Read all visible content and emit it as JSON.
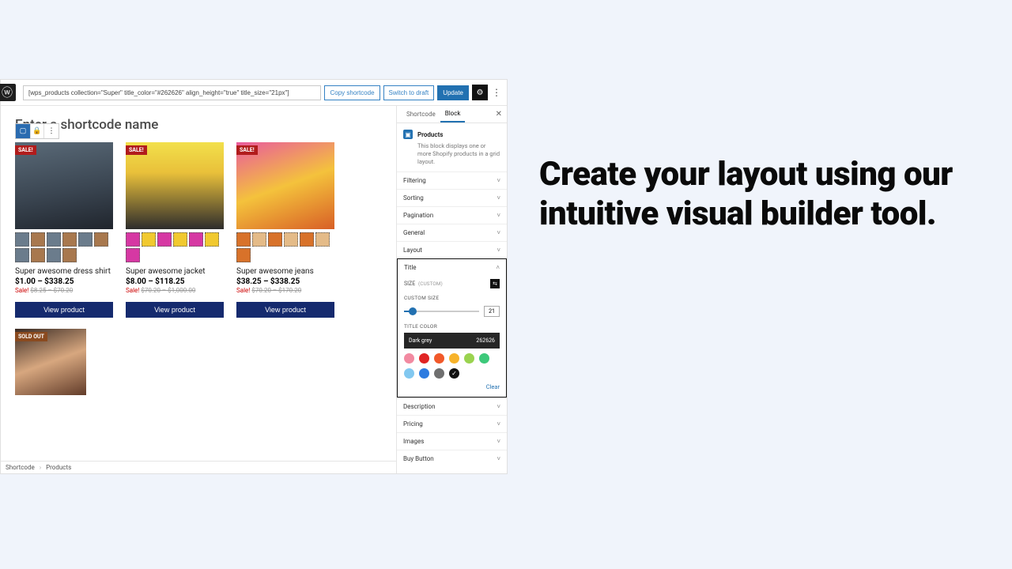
{
  "headline": "Create your layout using our intuitive visual builder tool.",
  "topbar": {
    "shortcode": "[wps_products collection=\"Super\" title_color=\"#262626\" align_height=\"true\" title_size=\"21px\"]",
    "copy": "Copy shortcode",
    "draft": "Switch to draft",
    "update": "Update"
  },
  "canvas": {
    "heading": "Enter a shortcode name"
  },
  "products": [
    {
      "badge": "SALE!",
      "badgeClass": "sale",
      "heroClass": "h1",
      "thumbCount": 10,
      "name": "Super awesome dress shirt",
      "price": "$1.00 – $338.25",
      "sale_prefix": "Sale!",
      "sale_old": "$8.25 – $70.20",
      "button": "View product"
    },
    {
      "badge": "SALE!",
      "badgeClass": "sale",
      "heroClass": "h2",
      "thumbCount": 7,
      "name": "Super awesome jacket",
      "price": "$8.00 – $118.25",
      "sale_prefix": "Sale!",
      "sale_old": "$70.20 – $1,000.00",
      "button": "View product"
    },
    {
      "badge": "SALE!",
      "badgeClass": "sale",
      "heroClass": "h3",
      "thumbCount": 7,
      "name": "Super awesome jeans",
      "price": "$38.25 – $338.25",
      "sale_prefix": "Sale!",
      "sale_old": "$70.20 – $170.20",
      "button": "View product"
    }
  ],
  "product_extra": {
    "badge": "SOLD OUT",
    "badgeClass": "soldout",
    "heroClass": "h4"
  },
  "breadcrumb": {
    "a": "Shortcode",
    "b": "Products"
  },
  "sidebar": {
    "tabs": {
      "a": "Shortcode",
      "b": "Block"
    },
    "block": {
      "title": "Products",
      "sub": "This block displays one or more Shopify products in a grid layout."
    },
    "panels_before": [
      "Filtering",
      "Sorting",
      "Pagination",
      "General",
      "Layout"
    ],
    "title_panel": {
      "label": "Title",
      "size_label": "SIZE",
      "size_custom": "(CUSTOM)",
      "custom_size_label": "CUSTOM SIZE",
      "custom_size_value": "21",
      "title_color_label": "TITLE COLOR",
      "swatch_name": "Dark grey",
      "swatch_hex": "262626",
      "colors": [
        "#f28aa1",
        "#e02424",
        "#f1592a",
        "#f7b32b",
        "#9ad34f",
        "#3dc97a",
        "#82c8f0",
        "#2d7be0",
        "#6f6f6f",
        "#111111"
      ],
      "checked_index": 9,
      "clear": "Clear"
    },
    "panels_after": [
      "Description",
      "Pricing",
      "Images",
      "Buy Button"
    ]
  }
}
